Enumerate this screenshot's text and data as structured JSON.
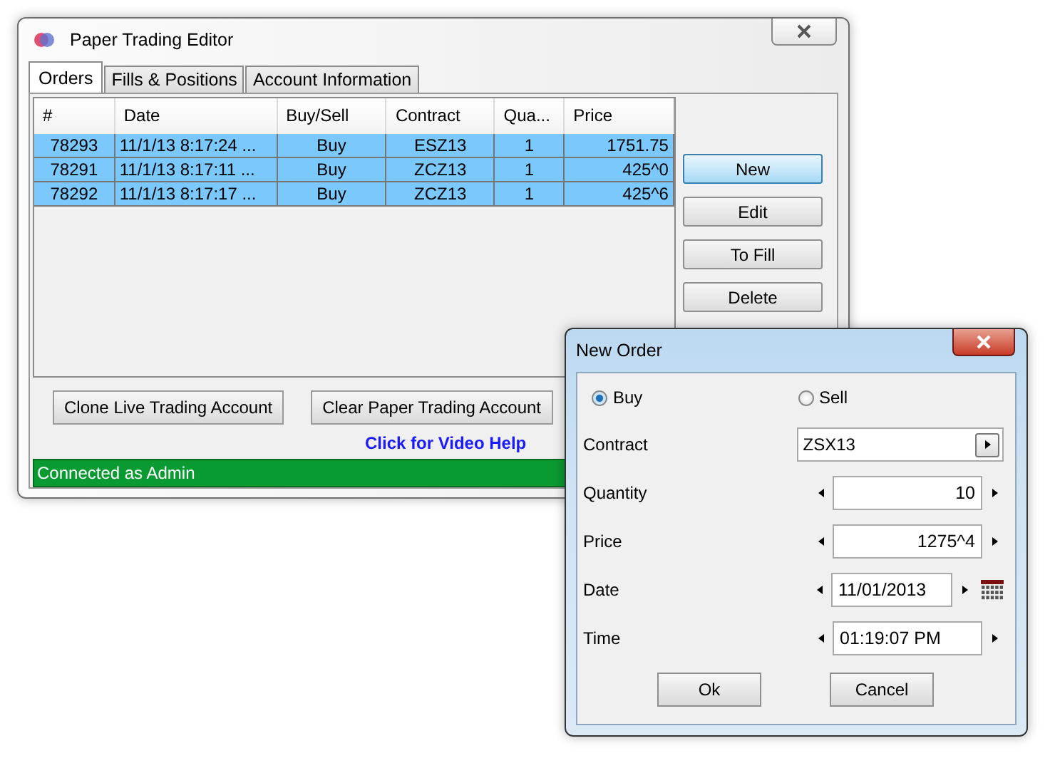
{
  "main_window": {
    "title": "Paper Trading Editor",
    "tabs": [
      {
        "label": "Orders",
        "selected": true
      },
      {
        "label": "Fills & Positions",
        "selected": false
      },
      {
        "label": "Account Information",
        "selected": false
      }
    ],
    "table": {
      "columns": [
        "#",
        "Date",
        "Buy/Sell",
        "Contract",
        "Qua...",
        "Price"
      ],
      "rows": [
        {
          "cells": [
            "78293",
            "11/1/13 8:17:24 ...",
            "Buy",
            "ESZ13",
            "1",
            "1751.75"
          ],
          "selected": true
        },
        {
          "cells": [
            "78291",
            "11/1/13 8:17:11 ...",
            "Buy",
            "ZCZ13",
            "1",
            "425^0"
          ],
          "selected": true
        },
        {
          "cells": [
            "78292",
            "11/1/13 8:17:17 ...",
            "Buy",
            "ZCZ13",
            "1",
            "425^6"
          ],
          "selected": true
        }
      ]
    },
    "side_buttons": [
      {
        "label": "New",
        "highlighted": true
      },
      {
        "label": "Edit",
        "highlighted": false
      },
      {
        "label": "To Fill",
        "highlighted": false
      },
      {
        "label": "Delete",
        "highlighted": false
      }
    ],
    "bottom_buttons": [
      "Clone Live Trading Account",
      "Clear Paper Trading Account"
    ],
    "help_link": "Click for Video Help",
    "status_bar": "Connected as Admin"
  },
  "dialog": {
    "title": "New Order",
    "sides": [
      {
        "label": "Buy",
        "selected": true
      },
      {
        "label": "Sell",
        "selected": false
      }
    ],
    "fields": [
      {
        "kind": "dropdown",
        "label": "Contract",
        "value": "ZSX13"
      },
      {
        "kind": "spinner",
        "label": "Quantity",
        "value": "10"
      },
      {
        "kind": "spinner",
        "label": "Price",
        "value": "1275^4"
      },
      {
        "kind": "date",
        "label": "Date",
        "value": "11/01/2013"
      },
      {
        "kind": "time",
        "label": "Time",
        "value": "01:19:07 PM"
      }
    ],
    "buttons": [
      "Ok",
      "Cancel"
    ]
  }
}
